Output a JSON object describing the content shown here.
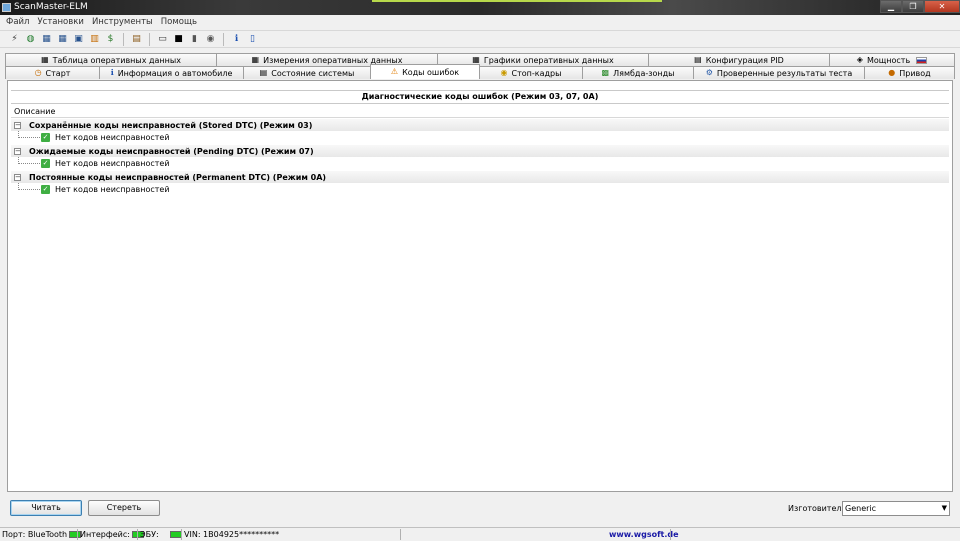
{
  "window": {
    "title": "ScanMaster-ELM"
  },
  "menu": [
    "Файл",
    "Установки",
    "Инструменты",
    "Помощь"
  ],
  "toolbar_icons": [
    "connect-icon",
    "globe-icon",
    "table-icon",
    "table2-icon",
    "gauge-icon",
    "chart-icon",
    "money-icon",
    "clipboard-icon",
    "window-icon",
    "terminal-icon",
    "battery-icon",
    "disc-icon",
    "info-icon",
    "book-icon"
  ],
  "tabs": {
    "row1": [
      {
        "label": "Таблица оперативных данных",
        "icon": "▦"
      },
      {
        "label": "Измерения оперативных данных",
        "icon": "▦"
      },
      {
        "label": "Графики оперативных данных",
        "icon": "▦"
      },
      {
        "label": "Конфигурация PID",
        "icon": "▤"
      },
      {
        "label": "Мощность",
        "icon": "◈"
      }
    ],
    "row2": [
      {
        "label": "Старт",
        "icon": "◷"
      },
      {
        "label": "Информация о автомобиле",
        "icon": "ℹ"
      },
      {
        "label": "Состояние системы",
        "icon": "▤"
      },
      {
        "label": "Коды ошибок",
        "icon": "⚠"
      },
      {
        "label": "Стоп-кадры",
        "icon": "◉"
      },
      {
        "label": "Лямбда-зонды",
        "icon": "▩"
      },
      {
        "label": "Проверенные результаты теста",
        "icon": "⚙"
      },
      {
        "label": "Привод",
        "icon": "●"
      }
    ]
  },
  "panel": {
    "header": "Диагностические коды ошибок (Режим 03, 07, 0A)",
    "column": "Описание",
    "groups": [
      {
        "title": "Сохранённые коды неисправностей (Stored DTC) (Режим 03)",
        "item": "Нет кодов неисправностей"
      },
      {
        "title": "Ожидаемые коды неисправностей (Pending DTC) (Режим 07)",
        "item": "Нет кодов неисправностей"
      },
      {
        "title": "Постоянные коды неисправностей (Permanent DTC) (Режим 0A)",
        "item": "Нет кодов неисправностей"
      }
    ]
  },
  "buttons": {
    "read": "Читать",
    "erase": "Стереть"
  },
  "manufacturer": {
    "label": "Изготовитель",
    "value": "Generic"
  },
  "status": {
    "port": "Порт: BlueTooth",
    "interface": "Интерфейс:",
    "ecu": "ЭБУ:",
    "vin": "VIN: 1B04925**********",
    "url": "www.wgsoft.de"
  },
  "colors": {
    "led": "#22cc22",
    "ok_icon": "#3fae43",
    "active_border": "#3c7fb1"
  }
}
